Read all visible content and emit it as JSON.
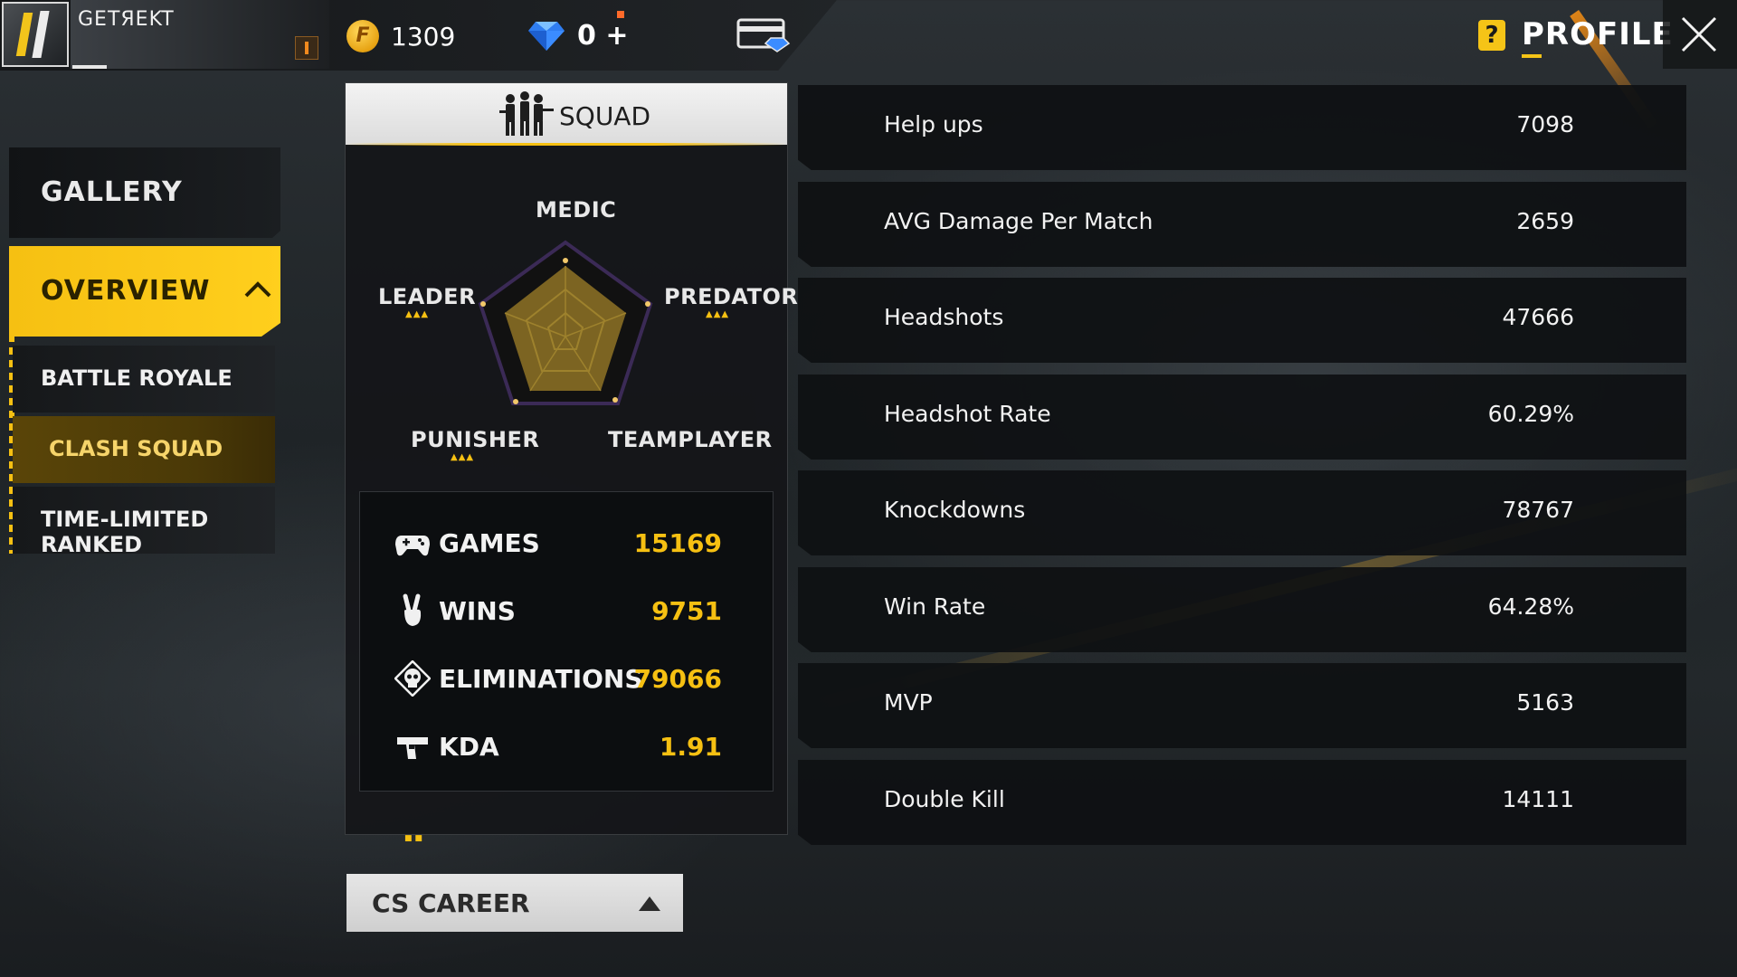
{
  "header": {
    "player_name": "GETЯEKT",
    "coins": "1309",
    "diamonds": "0",
    "diamonds_add": "+",
    "coin_symbol": "F",
    "help_symbol": "?",
    "title": "PROFILE"
  },
  "nav": {
    "gallery": "GALLERY",
    "overview": "OVERVIEW",
    "battle_royale": "BATTLE ROYALE",
    "clash_squad": "CLASH SQUAD",
    "time_limited_ranked": "TIME-LIMITED RANKED"
  },
  "squad": {
    "tab_label": "SQUAD",
    "roles": {
      "medic": "MEDIC",
      "leader": "LEADER",
      "predator": "PREDATOR",
      "punisher": "PUNISHER",
      "teamplayer": "TEAMPLAYER"
    },
    "stats": [
      {
        "label": "GAMES",
        "value": "15169",
        "icon": "gamepad-icon"
      },
      {
        "label": "WINS",
        "value": "9751",
        "icon": "victory-hand-icon"
      },
      {
        "label": "ELIMINATIONS",
        "value": "79066",
        "icon": "skull-icon"
      },
      {
        "label": "KDA",
        "value": "1.91",
        "icon": "pistol-icon"
      }
    ]
  },
  "career_button": "CS CAREER",
  "metrics": [
    {
      "label": "Help ups",
      "value": "7098"
    },
    {
      "label": "AVG Damage Per Match",
      "value": "2659"
    },
    {
      "label": "Headshots",
      "value": "47666"
    },
    {
      "label": "Headshot Rate",
      "value": "60.29%"
    },
    {
      "label": "Knockdowns",
      "value": "78767"
    },
    {
      "label": "Win Rate",
      "value": "64.28%"
    },
    {
      "label": "MVP",
      "value": "5163"
    },
    {
      "label": "Double Kill",
      "value": "14111"
    }
  ],
  "colors": {
    "accent": "#f6c012",
    "panel": "#141618",
    "text": "#f2f2f2"
  }
}
